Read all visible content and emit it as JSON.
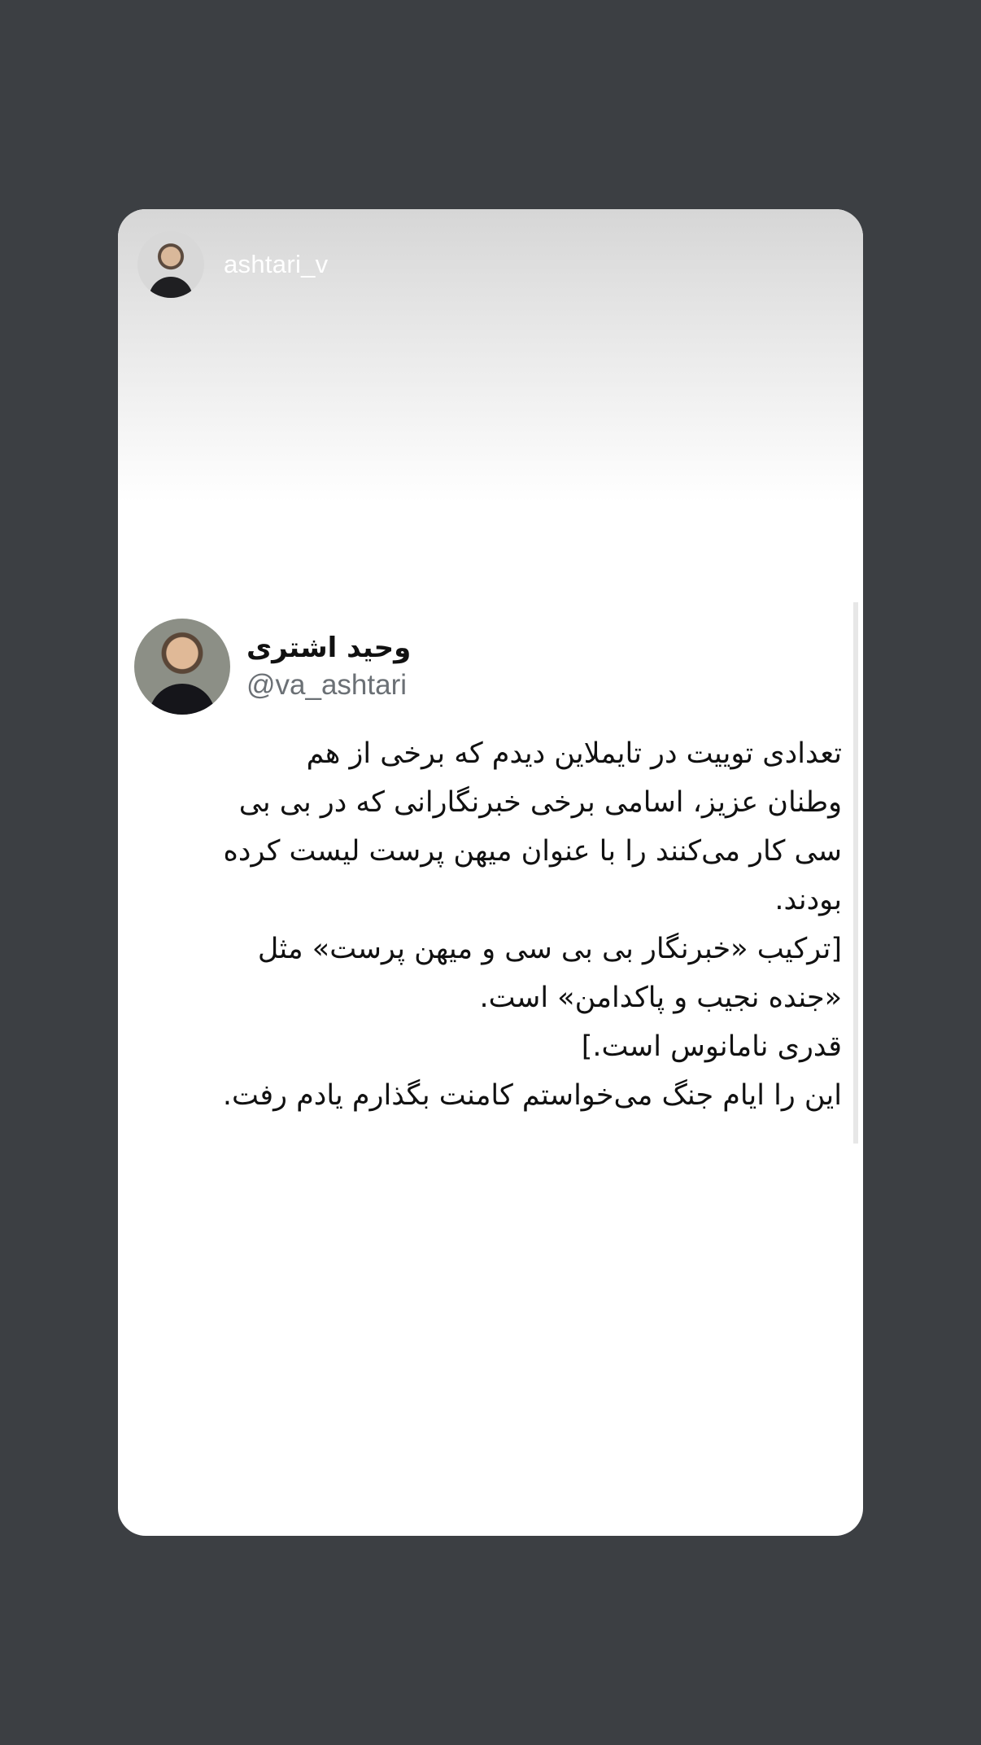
{
  "story": {
    "username": "ashtari_v"
  },
  "tweet": {
    "display_name": "وحید اشتری",
    "handle": "@va_ashtari",
    "lines": [
      "تعدادی توییت در تایملاین دیدم که برخی از هم",
      "وطنان عزیز، اسامی برخی خبرنگارانی که در بی بی",
      "سی کار می‌کنند را با عنوان میهن پرست لیست کرده",
      "بودند.",
      "[ترکیب «خبرنگار بی بی سی و میهن پرست» مثل",
      "«جنده نجیب و پاکدامن» است.",
      "قدری نامانوس است.]",
      "این را ایام جنگ می‌خواستم کامنت بگذارم یادم رفت."
    ]
  }
}
